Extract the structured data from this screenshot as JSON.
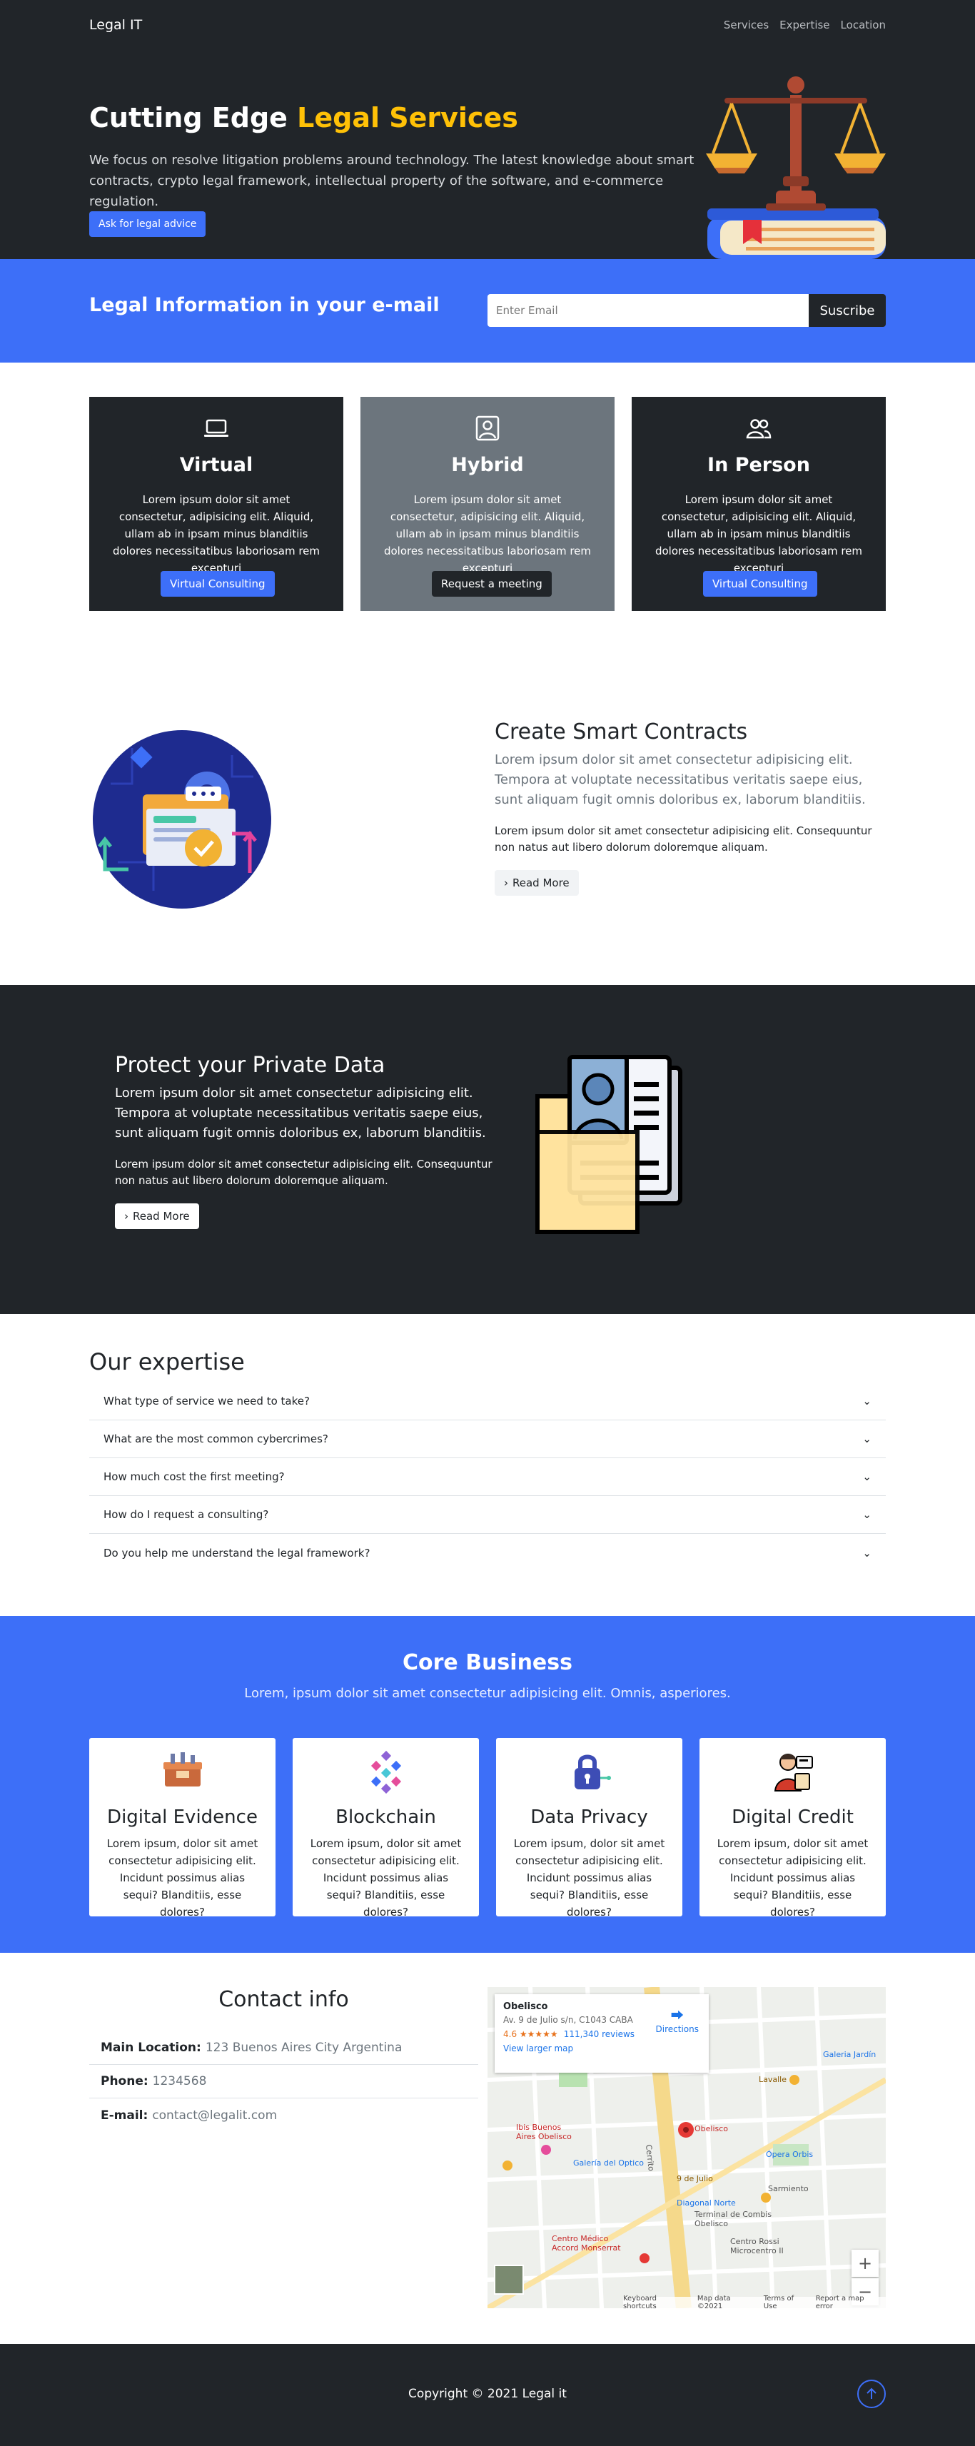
{
  "nav": {
    "brand": "Legal IT",
    "links": [
      "Services",
      "Expertise",
      "Location"
    ]
  },
  "hero": {
    "title_main": "Cutting Edge ",
    "title_accent": "Legal Services",
    "text": "We focus on resolve litigation problems around technology. The latest knowledge about smart contracts, crypto legal framework, intellectual property of the software, and e-commerce regulation.",
    "button": "Ask for legal advice",
    "icon": "scales-of-justice-illustration"
  },
  "newsletter": {
    "title": "Legal Information in your e-mail",
    "placeholder": "Enter Email",
    "button": "Suscribe"
  },
  "services": [
    {
      "icon": "laptop-icon",
      "title": "Virtual",
      "text": "Lorem ipsum dolor sit amet consectetur, adipisicing elit. Aliquid, ullam ab in ipsam minus blanditiis dolores necessitatibus laboriosam rem excepturi",
      "button": "Virtual Consulting"
    },
    {
      "icon": "person-badge-icon",
      "title": "Hybrid",
      "text": "Lorem ipsum dolor sit amet consectetur, adipisicing elit. Aliquid, ullam ab in ipsam minus blanditiis dolores necessitatibus laboriosam rem excepturi",
      "button": "Request a meeting"
    },
    {
      "icon": "people-icon",
      "title": "In Person",
      "text": "Lorem ipsum dolor sit amet consectetur, adipisicing elit. Aliquid, ullam ab in ipsam minus blanditiis dolores necessitatibus laboriosam rem excepturi",
      "button": "Virtual Consulting"
    }
  ],
  "smart": {
    "title": "Create Smart Contracts",
    "lead": "Lorem ipsum dolor sit amet consectetur adipisicing elit. Tempora at voluptate necessitatibus veritatis saepe eius, sunt aliquam fugit omnis doloribus ex, laborum blanditiis.",
    "text": "Lorem ipsum dolor sit amet consectetur adipisicing elit. Consequuntur non natus aut libero dolorum doloremque aliquam.",
    "button": "Read More"
  },
  "protect": {
    "title": "Protect your Private Data",
    "lead": "Lorem ipsum dolor sit amet consectetur adipisicing elit. Tempora at voluptate necessitatibus veritatis saepe eius, sunt aliquam fugit omnis doloribus ex, laborum blanditiis.",
    "text": "Lorem ipsum dolor sit amet consectetur adipisicing elit. Consequuntur non natus aut libero dolorum doloremque aliquam.",
    "button": "Read More"
  },
  "expertise": {
    "title": "Our expertise",
    "items": [
      "What type of service we need to take?",
      "What are the most common cybercrimes?",
      "How much cost the first meeting?",
      "How do I request a consulting?",
      "Do you help me understand the legal framework?"
    ]
  },
  "core": {
    "title": "Core Business",
    "subtitle": "Lorem, ipsum dolor sit amet consectetur adipisicing elit. Omnis, asperiores.",
    "cards": [
      {
        "icon": "evidence-box-icon",
        "title": "Digital Evidence",
        "text": "Lorem ipsum, dolor sit amet consectetur adipisicing elit. Incidunt possimus alias sequi? Blanditiis, esse dolores?"
      },
      {
        "icon": "blockchain-icon",
        "title": "Blockchain",
        "text": "Lorem ipsum, dolor sit amet consectetur adipisicing elit. Incidunt possimus alias sequi? Blanditiis, esse dolores?"
      },
      {
        "icon": "padlock-icon",
        "title": "Data Privacy",
        "text": "Lorem ipsum, dolor sit amet consectetur adipisicing elit. Incidunt possimus alias sequi? Blanditiis, esse dolores?"
      },
      {
        "icon": "credit-person-icon",
        "title": "Digital Credit",
        "text": "Lorem ipsum, dolor sit amet consectetur adipisicing elit. Incidunt possimus alias sequi? Blanditiis, esse dolores?"
      }
    ]
  },
  "contact": {
    "title": "Contact info",
    "rows": [
      {
        "label": "Main Location:",
        "value": "123 Buenos Aires City Argentina"
      },
      {
        "label": "Phone:",
        "value": "1234568"
      },
      {
        "label": "E-mail:",
        "value": "contact@legalit.com"
      }
    ],
    "map": {
      "place": "Obelisco",
      "address": "Av. 9 de Julio s/n, C1043 CABA",
      "rating": "4.6 ★★★★★",
      "reviews": "111,340 reviews",
      "larger": "View larger map",
      "directions": "Directions",
      "zoom_in": "+",
      "zoom_out": "−",
      "footer": [
        "Keyboard shortcuts",
        "Map data ©2021",
        "Terms of Use",
        "Report a map error"
      ],
      "labels": [
        "Obelisco",
        "Lavalle",
        "Ópera Orbis",
        "Galería del Optico",
        "Diagonal Norte",
        "Centro Rossi Microcentro II",
        "Centro Médico Accord Monserrat",
        "Ibis Buenos Aires Obelisco",
        "Terminal de Combis Obelisco",
        "Cerrito",
        "Sarmiento",
        "9 de Julio",
        "Galeria Jardín"
      ]
    }
  },
  "footer": {
    "copyright": "Copyright © 2021 Legal it"
  },
  "colors": {
    "dark": "#212529",
    "primary": "#3d6ff8",
    "accent": "#ffc107",
    "gray": "#6c757d"
  }
}
